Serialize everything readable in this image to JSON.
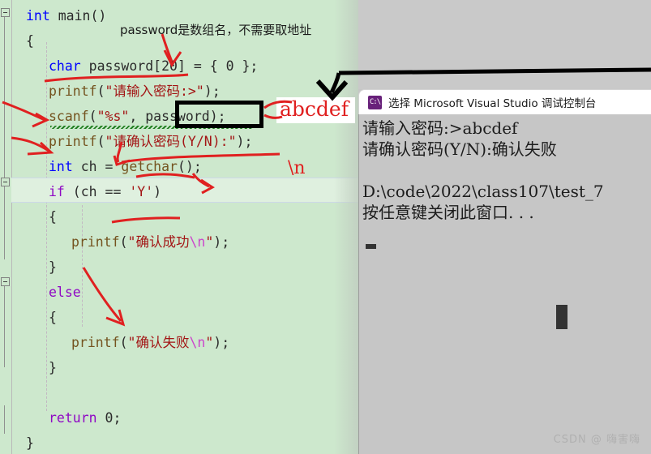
{
  "editor": {
    "language": "c",
    "background_color": "#cde8cd",
    "current_line_index": 6,
    "lines": [
      {
        "indent": 0,
        "tokens": [
          {
            "t": "int",
            "c": "kw"
          },
          {
            "t": " main()",
            "c": "plain"
          }
        ]
      },
      {
        "indent": 0,
        "tokens": [
          {
            "t": "{",
            "c": "plain"
          }
        ]
      },
      {
        "indent": 1,
        "tokens": [
          {
            "t": "char",
            "c": "kw"
          },
          {
            "t": " password[",
            "c": "plain"
          },
          {
            "t": "20",
            "c": "num"
          },
          {
            "t": "] = { ",
            "c": "plain"
          },
          {
            "t": "0",
            "c": "num"
          },
          {
            "t": " };",
            "c": "plain"
          }
        ]
      },
      {
        "indent": 1,
        "tokens": [
          {
            "t": "printf",
            "c": "fn"
          },
          {
            "t": "(",
            "c": "plain"
          },
          {
            "t": "\"请输入密码:>\"",
            "c": "str"
          },
          {
            "t": ");",
            "c": "plain"
          }
        ]
      },
      {
        "indent": 1,
        "tokens": [
          {
            "t": "scanf",
            "c": "fn"
          },
          {
            "t": "(",
            "c": "plain"
          },
          {
            "t": "\"%s\"",
            "c": "str"
          },
          {
            "t": ", password);",
            "c": "plain"
          }
        ]
      },
      {
        "indent": 1,
        "tokens": [
          {
            "t": "printf",
            "c": "fn"
          },
          {
            "t": "(",
            "c": "plain"
          },
          {
            "t": "\"请确认密码(Y/N):\"",
            "c": "str"
          },
          {
            "t": ");",
            "c": "plain"
          }
        ]
      },
      {
        "indent": 1,
        "tokens": [
          {
            "t": "int",
            "c": "kw"
          },
          {
            "t": " ch = ",
            "c": "plain"
          },
          {
            "t": "getchar",
            "c": "fn"
          },
          {
            "t": "();",
            "c": "plain"
          }
        ]
      },
      {
        "indent": 1,
        "tokens": [
          {
            "t": "if",
            "c": "kw2"
          },
          {
            "t": " (ch == ",
            "c": "plain"
          },
          {
            "t": "'Y'",
            "c": "str"
          },
          {
            "t": ")",
            "c": "plain"
          }
        ]
      },
      {
        "indent": 1,
        "tokens": [
          {
            "t": "{",
            "c": "plain"
          }
        ]
      },
      {
        "indent": 2,
        "tokens": [
          {
            "t": "printf",
            "c": "fn"
          },
          {
            "t": "(",
            "c": "plain"
          },
          {
            "t": "\"确认成功",
            "c": "str"
          },
          {
            "t": "\\n",
            "c": "esc"
          },
          {
            "t": "\"",
            "c": "str"
          },
          {
            "t": ");",
            "c": "plain"
          }
        ]
      },
      {
        "indent": 1,
        "tokens": [
          {
            "t": "}",
            "c": "plain"
          }
        ]
      },
      {
        "indent": 1,
        "tokens": [
          {
            "t": "else",
            "c": "kw2"
          }
        ]
      },
      {
        "indent": 1,
        "tokens": [
          {
            "t": "{",
            "c": "plain"
          }
        ]
      },
      {
        "indent": 2,
        "tokens": [
          {
            "t": "printf",
            "c": "fn"
          },
          {
            "t": "(",
            "c": "plain"
          },
          {
            "t": "\"确认失败",
            "c": "str"
          },
          {
            "t": "\\n",
            "c": "esc"
          },
          {
            "t": "\"",
            "c": "str"
          },
          {
            "t": ");",
            "c": "plain"
          }
        ]
      },
      {
        "indent": 1,
        "tokens": [
          {
            "t": "}",
            "c": "plain"
          }
        ]
      },
      {
        "indent": 0,
        "tokens": [
          {
            "t": "",
            "c": "plain"
          }
        ]
      },
      {
        "indent": 1,
        "tokens": [
          {
            "t": "return",
            "c": "kw2"
          },
          {
            "t": " ",
            "c": "plain"
          },
          {
            "t": "0",
            "c": "num"
          },
          {
            "t": ";",
            "c": "plain"
          }
        ]
      },
      {
        "indent": 0,
        "tokens": [
          {
            "t": "}",
            "c": "plain"
          }
        ]
      }
    ]
  },
  "annotations": {
    "note_array_name": "password是数组名，不需要取地址",
    "input_sample": "abcdef",
    "newline_marker": "\\n",
    "color_red": "#e02020",
    "color_black": "#000000"
  },
  "console": {
    "title": "选择 Microsoft Visual Studio 调试控制台",
    "icon": "console-app-icon",
    "icon_text": "C:\\",
    "lines": [
      "请输入密码:>abcdef",
      "请确认密码(Y/N):确认失败",
      "",
      "D:\\code\\2022\\class107\\test_7",
      "按任意键关闭此窗口. . ."
    ],
    "background_color": "#c6c6c6"
  },
  "watermark": "CSDN @  嗨害嗨"
}
